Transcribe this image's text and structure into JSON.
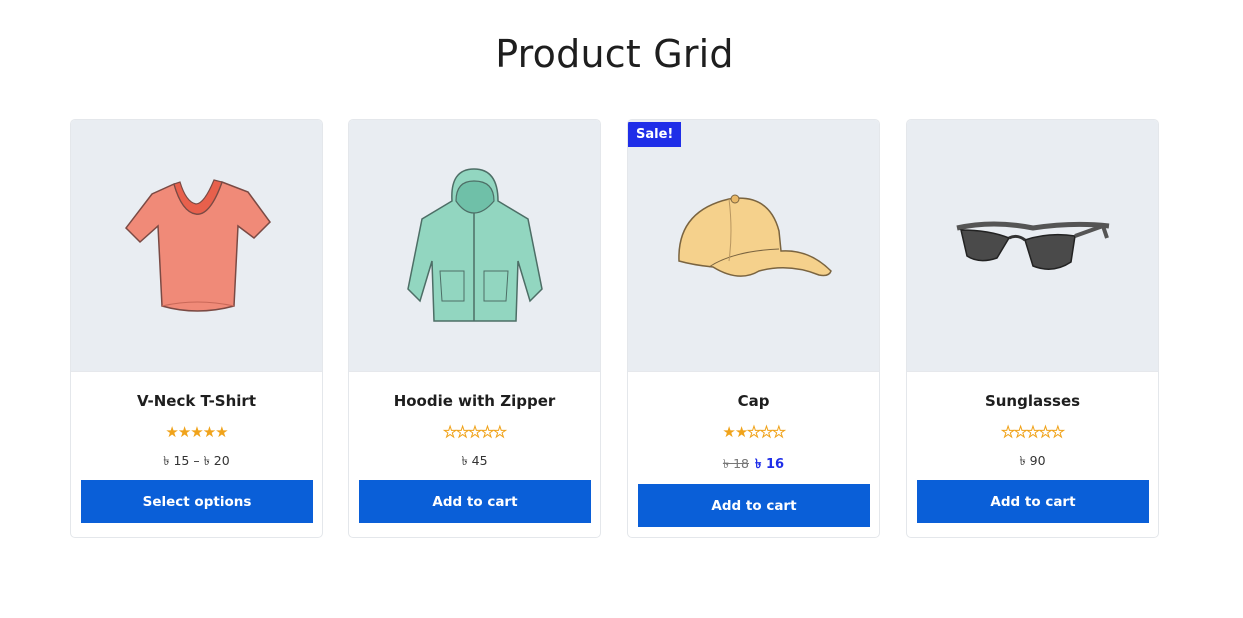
{
  "page": {
    "title": "Product Grid"
  },
  "colors": {
    "accent": "#0a5fd8",
    "sale_badge": "#1f2ee8",
    "star": "#f0a31b",
    "image_bg": "#e9edf2"
  },
  "products": [
    {
      "name": "V-Neck T-Shirt",
      "image_icon": "tshirt-icon",
      "rating_stars": 5,
      "price": "৳ 15 – ৳ 20",
      "button_label": "Select options"
    },
    {
      "name": "Hoodie with Zipper",
      "image_icon": "hoodie-icon",
      "rating_stars": 0,
      "price": "৳ 45",
      "button_label": "Add to cart"
    },
    {
      "name": "Cap",
      "image_icon": "cap-icon",
      "badge": "Sale!",
      "rating_stars": 2,
      "old_price": "৳ 18",
      "new_price": "৳ 16",
      "button_label": "Add to cart"
    },
    {
      "name": "Sunglasses",
      "image_icon": "sunglasses-icon",
      "rating_stars": 0,
      "price": "৳ 90",
      "button_label": "Add to cart"
    }
  ]
}
